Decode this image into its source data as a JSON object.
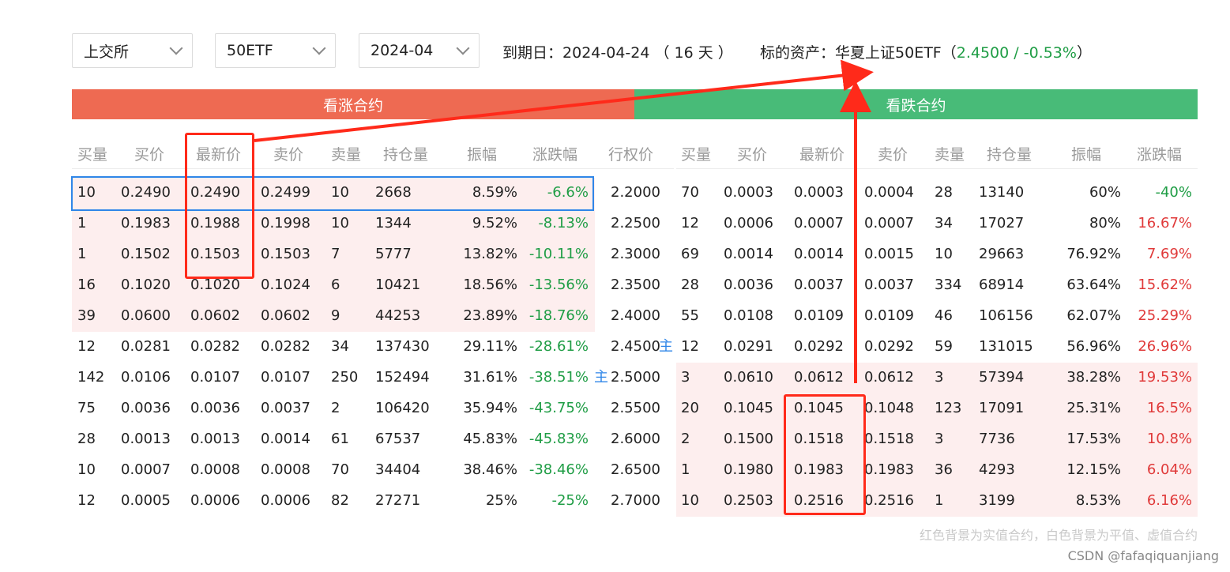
{
  "filters": {
    "exchange": "上交所",
    "underlying": "50ETF",
    "month": "2024-04"
  },
  "info": {
    "expiry_label": "到期日：",
    "expiry_date": "2024-04-24",
    "days_left": "（ 16 天 ）",
    "underlying_label": "标的资产：",
    "underlying_name": "华夏上证50ETF",
    "paren_open": "（",
    "price": "2.4500",
    "sep": " / ",
    "change": "-0.53%",
    "paren_close": "）"
  },
  "sections": {
    "call": "看涨合约",
    "put": "看跌合约"
  },
  "headers": {
    "call": [
      "买量",
      "买价",
      "最新价",
      "卖价",
      "卖量",
      "持仓量",
      "振幅",
      "涨跌幅"
    ],
    "strike": "行权价",
    "put": [
      "买量",
      "买价",
      "最新价",
      "卖价",
      "卖量",
      "持仓量",
      "振幅",
      "涨跌幅"
    ]
  },
  "main_tag": "主",
  "rows": [
    {
      "strike": "2.2000",
      "call": [
        "10",
        "0.2490",
        "0.2490",
        "0.2499",
        "10",
        "2668",
        "8.59%",
        "-6.6%"
      ],
      "put": [
        "70",
        "0.0003",
        "0.0003",
        "0.0004",
        "28",
        "13140",
        "60%",
        "-40%"
      ],
      "call_itm": true,
      "put_itm": false,
      "put_chg_dir": "down"
    },
    {
      "strike": "2.2500",
      "call": [
        "1",
        "0.1983",
        "0.1988",
        "0.1998",
        "10",
        "1344",
        "9.52%",
        "-8.13%"
      ],
      "put": [
        "12",
        "0.0006",
        "0.0007",
        "0.0007",
        "34",
        "17027",
        "80%",
        "16.67%"
      ],
      "call_itm": true,
      "put_itm": false,
      "put_chg_dir": "up"
    },
    {
      "strike": "2.3000",
      "call": [
        "1",
        "0.1502",
        "0.1503",
        "0.1503",
        "7",
        "5777",
        "13.82%",
        "-10.11%"
      ],
      "put": [
        "69",
        "0.0014",
        "0.0014",
        "0.0015",
        "10",
        "29663",
        "76.92%",
        "7.69%"
      ],
      "call_itm": true,
      "put_itm": false,
      "put_chg_dir": "up"
    },
    {
      "strike": "2.3500",
      "call": [
        "16",
        "0.1020",
        "0.1020",
        "0.1024",
        "6",
        "10421",
        "18.56%",
        "-13.56%"
      ],
      "put": [
        "28",
        "0.0036",
        "0.0037",
        "0.0037",
        "334",
        "68914",
        "63.64%",
        "15.62%"
      ],
      "call_itm": true,
      "put_itm": false,
      "put_chg_dir": "up"
    },
    {
      "strike": "2.4000",
      "call": [
        "39",
        "0.0600",
        "0.0602",
        "0.0602",
        "9",
        "44253",
        "23.89%",
        "-18.76%"
      ],
      "put": [
        "55",
        "0.0108",
        "0.0109",
        "0.0109",
        "46",
        "106156",
        "62.07%",
        "25.29%"
      ],
      "call_itm": true,
      "put_itm": false,
      "put_chg_dir": "up"
    },
    {
      "strike": "2.4500",
      "call": [
        "12",
        "0.0281",
        "0.0282",
        "0.0282",
        "34",
        "137430",
        "29.11%",
        "-28.61%"
      ],
      "put": [
        "12",
        "0.0291",
        "0.0292",
        "0.0292",
        "59",
        "131015",
        "56.96%",
        "26.96%"
      ],
      "call_itm": false,
      "put_itm": false,
      "put_chg_dir": "up",
      "strike_main": true
    },
    {
      "strike": "2.5000",
      "call": [
        "142",
        "0.0106",
        "0.0107",
        "0.0107",
        "250",
        "152494",
        "31.61%",
        "-38.51%"
      ],
      "put": [
        "3",
        "0.0610",
        "0.0612",
        "0.0612",
        "3",
        "57394",
        "38.28%",
        "19.53%"
      ],
      "call_itm": false,
      "put_itm": true,
      "put_chg_dir": "up",
      "call_main": true
    },
    {
      "strike": "2.5500",
      "call": [
        "75",
        "0.0036",
        "0.0036",
        "0.0037",
        "2",
        "106420",
        "35.94%",
        "-43.75%"
      ],
      "put": [
        "20",
        "0.1045",
        "0.1045",
        "0.1048",
        "123",
        "17091",
        "25.31%",
        "16.5%"
      ],
      "call_itm": false,
      "put_itm": true,
      "put_chg_dir": "up"
    },
    {
      "strike": "2.6000",
      "call": [
        "28",
        "0.0013",
        "0.0013",
        "0.0014",
        "61",
        "67537",
        "45.83%",
        "-45.83%"
      ],
      "put": [
        "2",
        "0.1500",
        "0.1518",
        "0.1518",
        "3",
        "7736",
        "17.53%",
        "10.8%"
      ],
      "call_itm": false,
      "put_itm": true,
      "put_chg_dir": "up"
    },
    {
      "strike": "2.6500",
      "call": [
        "10",
        "0.0007",
        "0.0008",
        "0.0008",
        "70",
        "34404",
        "38.46%",
        "-38.46%"
      ],
      "put": [
        "1",
        "0.1980",
        "0.1983",
        "0.1983",
        "36",
        "4293",
        "12.15%",
        "6.04%"
      ],
      "call_itm": false,
      "put_itm": true,
      "put_chg_dir": "up"
    },
    {
      "strike": "2.7000",
      "call": [
        "12",
        "0.0005",
        "0.0006",
        "0.0006",
        "82",
        "27271",
        "25%",
        "-25%"
      ],
      "put": [
        "10",
        "0.2503",
        "0.2516",
        "0.2516",
        "1",
        "3199",
        "8.53%",
        "6.16%"
      ],
      "call_itm": false,
      "put_itm": true,
      "put_chg_dir": "up"
    }
  ],
  "colors": {
    "up": "#e03a3a",
    "down": "#1f9d45",
    "itm_bg": "#fdeeee",
    "call_bar": "#ee6a52",
    "put_bar": "#48bb78"
  },
  "footnote": "红色背景为实值合约，白色背景为平值、虚值合约",
  "watermark": "CSDN @fafaqiquanjiang"
}
